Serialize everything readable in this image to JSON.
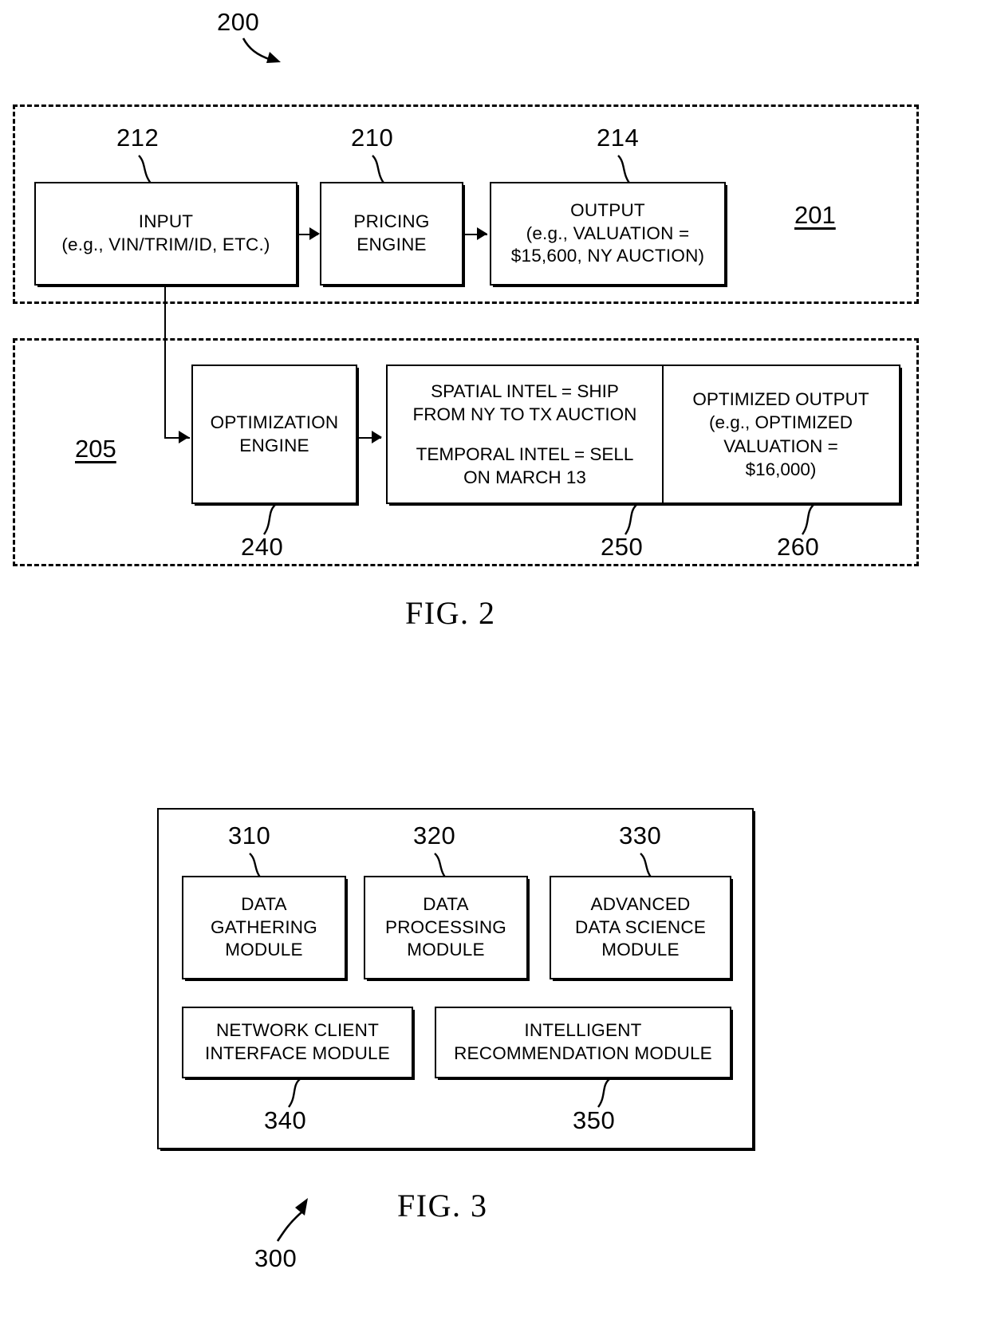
{
  "figures": [
    {
      "id": "fig2",
      "caption": "FIG. 2",
      "system_numeral": "200",
      "groups": [
        {
          "numeral": "201"
        },
        {
          "numeral": "205"
        }
      ],
      "blocks": [
        {
          "numeral": "212",
          "name": "input-block",
          "lines": [
            "INPUT",
            "(e.g., VIN/TRIM/ID, ETC.)"
          ]
        },
        {
          "numeral": "210",
          "name": "pricing-engine-block",
          "lines": [
            "PRICING",
            "ENGINE"
          ]
        },
        {
          "numeral": "214",
          "name": "output-block",
          "lines": [
            "OUTPUT",
            "(e.g., VALUATION =",
            "$15,600, NY AUCTION)"
          ]
        },
        {
          "numeral": "240",
          "name": "optimization-engine-block",
          "lines": [
            "OPTIMIZATION",
            "ENGINE"
          ]
        },
        {
          "numeral": "250",
          "name": "intel-block",
          "group_a": [
            "SPATIAL INTEL = SHIP",
            "FROM NY TO TX AUCTION"
          ],
          "group_b": [
            "TEMPORAL INTEL = SELL",
            "ON MARCH 13"
          ]
        },
        {
          "numeral": "260",
          "name": "optimized-output-block",
          "lines": [
            "OPTIMIZED OUTPUT",
            "(e.g., OPTIMIZED",
            "VALUATION =",
            "$16,000)"
          ]
        }
      ]
    },
    {
      "id": "fig3",
      "caption": "FIG. 3",
      "system_numeral": "300",
      "modules": [
        {
          "numeral": "310",
          "name": "data-gathering-module",
          "lines": [
            "DATA",
            "GATHERING",
            "MODULE"
          ]
        },
        {
          "numeral": "320",
          "name": "data-processing-module",
          "lines": [
            "DATA",
            "PROCESSING",
            "MODULE"
          ]
        },
        {
          "numeral": "330",
          "name": "advanced-data-science-module",
          "lines": [
            "ADVANCED",
            "DATA SCIENCE",
            "MODULE"
          ]
        },
        {
          "numeral": "340",
          "name": "network-client-interface-module",
          "lines": [
            "NETWORK CLIENT",
            "INTERFACE MODULE"
          ]
        },
        {
          "numeral": "350",
          "name": "intelligent-recommendation-module",
          "lines": [
            "INTELLIGENT",
            "RECOMMENDATION MODULE"
          ]
        }
      ]
    }
  ],
  "colors": {
    "ink": "#000000",
    "paper": "#ffffff"
  }
}
